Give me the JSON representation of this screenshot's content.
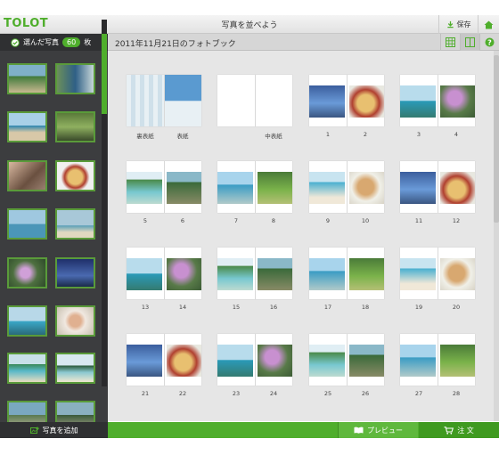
{
  "app": {
    "logo": "TOLOT",
    "title": "写真を並べよう"
  },
  "toolbar": {
    "save_label": "保存"
  },
  "sidebar": {
    "selected_label": "選んだ写真",
    "selected_count": "60",
    "count_unit": "枚",
    "add_label": "写真を追加"
  },
  "content": {
    "book_title": "2011年11月21日のフォトブック"
  },
  "bottom": {
    "preview_label": "プレビュー",
    "order_label": "注 文"
  },
  "colors": {
    "accent": "#4fae2c",
    "sidebar_bg": "#3c3d3f",
    "canvas_bg": "#e6e6e6"
  },
  "pages": [
    {
      "left": "裏表紙",
      "right": "表紙"
    },
    {
      "left": "",
      "right": "中表紙"
    },
    {
      "left": "1",
      "right": "2"
    },
    {
      "left": "3",
      "right": "4"
    },
    {
      "left": "5",
      "right": "6"
    },
    {
      "left": "7",
      "right": "8"
    },
    {
      "left": "9",
      "right": "10"
    },
    {
      "left": "11",
      "right": "12"
    },
    {
      "left": "13",
      "right": "14"
    },
    {
      "left": "15",
      "right": "16"
    },
    {
      "left": "17",
      "right": "18"
    },
    {
      "left": "19",
      "right": "20"
    },
    {
      "left": "21",
      "right": "22"
    },
    {
      "left": "23",
      "right": "24"
    },
    {
      "left": "25",
      "right": "26"
    },
    {
      "left": "27",
      "right": "28"
    }
  ]
}
